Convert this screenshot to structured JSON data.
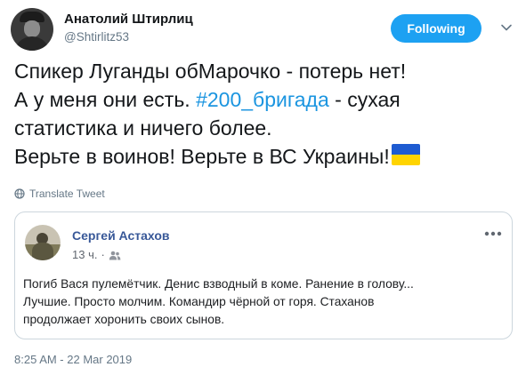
{
  "author": {
    "display_name": "Анатолий Штирлиц",
    "handle": "@Shtirlitz53"
  },
  "follow_button": {
    "label": "Following",
    "color": "#1da1f2"
  },
  "tweet": {
    "line1": "Спикер Луганды обМарочко - потерь нет!",
    "line2_before": "А у меня они есть. ",
    "line2_hashtag": "#200_бригада",
    "line2_after": " - сухая",
    "line3": "статистика  и ничего более.",
    "line4": "Верьте в воинов! Верьте в ВС Украины!",
    "hashtag_color": "#1b95e0",
    "flag_icon": "ukraine-flag-icon"
  },
  "translate": {
    "label": "Translate Tweet",
    "icon": "globe-icon"
  },
  "embedded_post": {
    "author": "Сергей Астахов",
    "time": "13 ч.",
    "separator": "·",
    "audience_icon": "friends-icon",
    "menu_icon": "more-dots-icon",
    "lines": [
      "Погиб Вася пулемётчик. Денис взводный в коме. Ранение в голову...",
      "Лучшие. Просто молчим. Командир чёрной от горя. Стаханов",
      "продолжает хоронить своих сынов."
    ]
  },
  "timestamp": "8:25 AM - 22 Mar 2019"
}
